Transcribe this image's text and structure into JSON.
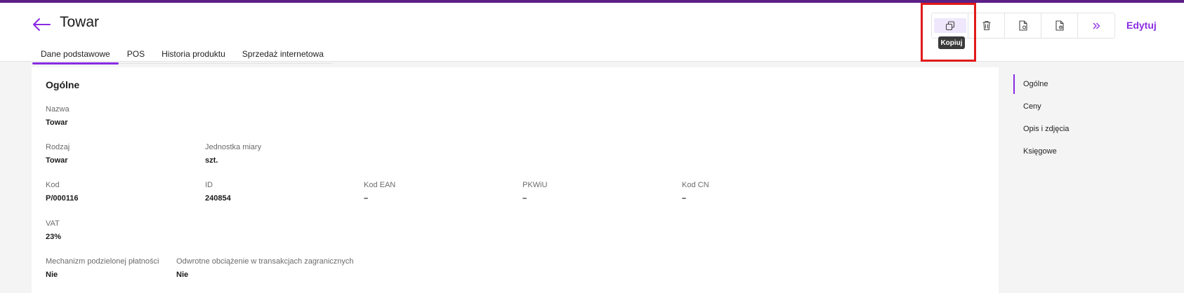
{
  "header": {
    "title": "Towar",
    "tabs": [
      {
        "label": "Dane podstawowe"
      },
      {
        "label": "POS"
      },
      {
        "label": "Historia produktu"
      },
      {
        "label": "Sprzedaż internetowa"
      }
    ],
    "toolbar": {
      "copy_tooltip": "Kopiuj",
      "edit_label": "Edytuj"
    }
  },
  "section": {
    "title": "Ogólne",
    "fields": {
      "nazwa": {
        "label": "Nazwa",
        "value": "Towar"
      },
      "rodzaj": {
        "label": "Rodzaj",
        "value": "Towar"
      },
      "jednostka": {
        "label": "Jednostka miary",
        "value": "szt."
      },
      "kod": {
        "label": "Kod",
        "value": "P/000116"
      },
      "id": {
        "label": "ID",
        "value": "240854"
      },
      "ean": {
        "label": "Kod EAN",
        "value": "–"
      },
      "pkwiu": {
        "label": "PKWiU",
        "value": "–"
      },
      "cn": {
        "label": "Kod CN",
        "value": "–"
      },
      "vat": {
        "label": "VAT",
        "value": "23%"
      },
      "mpp": {
        "label": "Mechanizm podzielonej płatności",
        "value": "Nie"
      },
      "odwrotne": {
        "label": "Odwrotne obciążenie w transakcjach zagranicznych",
        "value": "Nie"
      }
    }
  },
  "rightnav": {
    "items": [
      {
        "label": "Ogólne"
      },
      {
        "label": "Ceny"
      },
      {
        "label": "Opis i zdjęcia"
      },
      {
        "label": "Księgowe"
      }
    ]
  },
  "colors": {
    "accent": "#8a2be2",
    "topbar": "#5b1f86",
    "highlight": "#e11a1a"
  }
}
